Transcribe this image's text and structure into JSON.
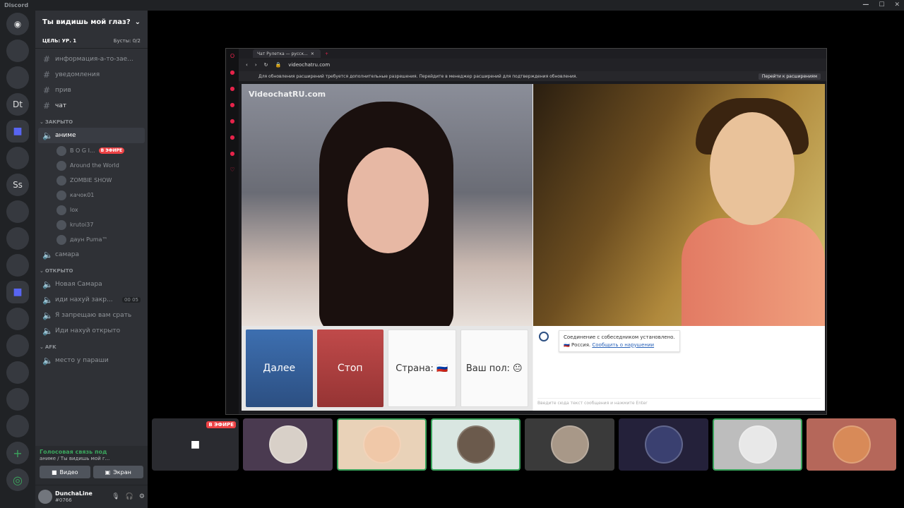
{
  "app_title": "Discord",
  "server": {
    "name": "Ты видишь мой глаз?",
    "goal": "ЦЕЛЬ: УР. 1",
    "boosts": "Бусты: 0/2"
  },
  "guilds": [
    {
      "label": "",
      "icon": "discord-home-icon"
    },
    {
      "label": "",
      "icon": "server-avatar"
    },
    {
      "label": "",
      "icon": "server-avatar"
    },
    {
      "label": "Dt",
      "icon": ""
    },
    {
      "label": "",
      "icon": "folder-icon"
    },
    {
      "label": "",
      "icon": "server-avatar"
    },
    {
      "label": "Ss",
      "icon": ""
    },
    {
      "label": "",
      "icon": "server-avatar"
    },
    {
      "label": "",
      "icon": "server-avatar"
    },
    {
      "label": "",
      "icon": "server-avatar"
    },
    {
      "label": "",
      "icon": "folder-icon"
    },
    {
      "label": "",
      "icon": "server-avatar"
    },
    {
      "label": "",
      "icon": "server-avatar"
    },
    {
      "label": "",
      "icon": "server-avatar"
    },
    {
      "label": "",
      "icon": "server-avatar"
    },
    {
      "label": "",
      "icon": "server-avatar"
    }
  ],
  "text_channels": [
    {
      "name": "информация-а-то-зае..."
    },
    {
      "name": "уведомления"
    },
    {
      "name": "прив"
    },
    {
      "name": "чат"
    }
  ],
  "categories": {
    "closed": "ЗАКРЫТО",
    "open": "ОТКРЫТО",
    "afk": "AFK"
  },
  "closed_channels": {
    "anime": "аниме",
    "samara": "самара"
  },
  "voice_users": [
    {
      "name": "B O G I...",
      "badge": "В ЭФИРЕ"
    },
    {
      "name": "Around the World",
      "badge": ""
    },
    {
      "name": "ZOMBIE SHOW",
      "badge": ""
    },
    {
      "name": "качок01",
      "badge": ""
    },
    {
      "name": "lox",
      "badge": ""
    },
    {
      "name": "krutoi37",
      "badge": ""
    },
    {
      "name": "даун Puma™",
      "badge": ""
    }
  ],
  "open_channels": [
    {
      "name": "Новая Самара",
      "count": ""
    },
    {
      "name": "иди нахуй закр...",
      "count": "00  05"
    },
    {
      "name": "Я запрещаю вам срать",
      "count": ""
    },
    {
      "name": "Иди нахуй открыто",
      "count": ""
    }
  ],
  "afk_channel": "место у параши",
  "voice_panel": {
    "status": "Голосовая связь под",
    "sub": "аниме / Ты видишь мой г...",
    "video_btn": "Видео",
    "screen_btn": "Экран"
  },
  "user": {
    "name": "DunchaLine",
    "tag": "#0766"
  },
  "browser": {
    "tab_title": "Чат Рулетка — русск...",
    "url": "videochatru.com",
    "notice": "Для обновления расширений требуется дополнительные разрешения. Перейдите в менеджер расширений для подтверждения обновления.",
    "notice_btn": "Перейти к расширениям"
  },
  "site": {
    "watermark": "VideochatRU.com",
    "next_btn": "Далее",
    "stop_btn": "Стоп",
    "country_btn": "Страна: 🇷🇺",
    "gender_btn": "Ваш пол: 😐",
    "chat_msg_line1": "Соединение с собеседником установлено.",
    "chat_msg_country": "Россия.",
    "chat_msg_report": "Сообщить о нарушении",
    "chat_placeholder": "Введите сюда текст сообщения и нажмите Enter"
  },
  "tiles_live": "В ЭФИРЕ",
  "colors": {
    "discord_dark": "#202225",
    "channel_bg": "#2f3136",
    "live_red": "#ed4245",
    "voice_green": "#3ba55d"
  }
}
